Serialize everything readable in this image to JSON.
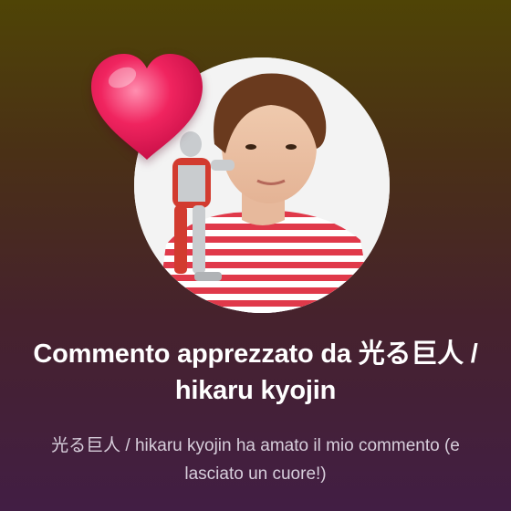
{
  "notification": {
    "title": "Commento apprezzato da 光る巨人 / hikaru kyojin",
    "message": "光る巨人 / hikaru kyojin ha amato il mio commento (e lasciato un cuore!)"
  },
  "icons": {
    "reaction": "heart-icon",
    "user": "avatar"
  },
  "colors": {
    "background_top": "#4f4406",
    "background_bottom": "#421e44",
    "heart": "#e8175a",
    "stripe": "#e0394a"
  }
}
